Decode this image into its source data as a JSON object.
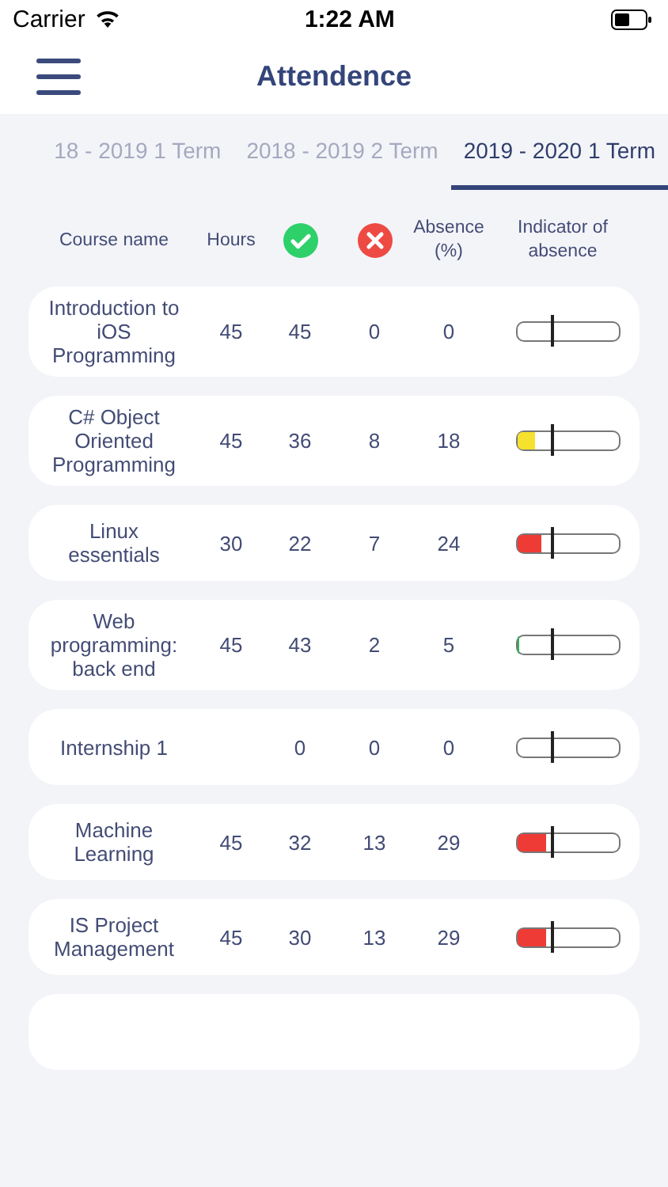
{
  "status_bar": {
    "carrier": "Carrier",
    "time": "1:22 AM"
  },
  "nav": {
    "title": "Attendence"
  },
  "tabs": [
    {
      "label": "18 - 2019 1 Term",
      "selected": false
    },
    {
      "label": "2018 - 2019 2 Term",
      "selected": false
    },
    {
      "label": "2019 - 2020 1 Term",
      "selected": true
    }
  ],
  "table": {
    "columns": {
      "course": "Course name",
      "hours": "Hours",
      "absence": "Absence (%)",
      "indicator": "Indicator of absence"
    },
    "rows": [
      {
        "course": "Introduction to iOS Programming",
        "hours": "45",
        "present": "45",
        "absent": "0",
        "absence": "0"
      },
      {
        "course": "C# Object Oriented Programming",
        "hours": "45",
        "present": "36",
        "absent": "8",
        "absence": "18",
        "level": 0.18,
        "color": "#f7e12f"
      },
      {
        "course": "Linux essentials",
        "hours": "30",
        "present": "22",
        "absent": "7",
        "absence": "24",
        "level": 0.24,
        "color": "#ee3b36"
      },
      {
        "course": "Web programming: back end",
        "hours": "45",
        "present": "43",
        "absent": "2",
        "absence": "5",
        "level": 0.03,
        "color": "#2fb45a"
      },
      {
        "course": "Internship 1",
        "present": "0",
        "absent": "0",
        "absence": "0"
      },
      {
        "course": "Machine Learning",
        "hours": "45",
        "present": "32",
        "absent": "13",
        "absence": "29",
        "level": 0.29,
        "color": "#ee3b36"
      },
      {
        "course": "IS Project Management",
        "hours": "45",
        "present": "30",
        "absent": "13",
        "absence": "29",
        "level": 0.29,
        "color": "#ee3b36"
      }
    ]
  }
}
